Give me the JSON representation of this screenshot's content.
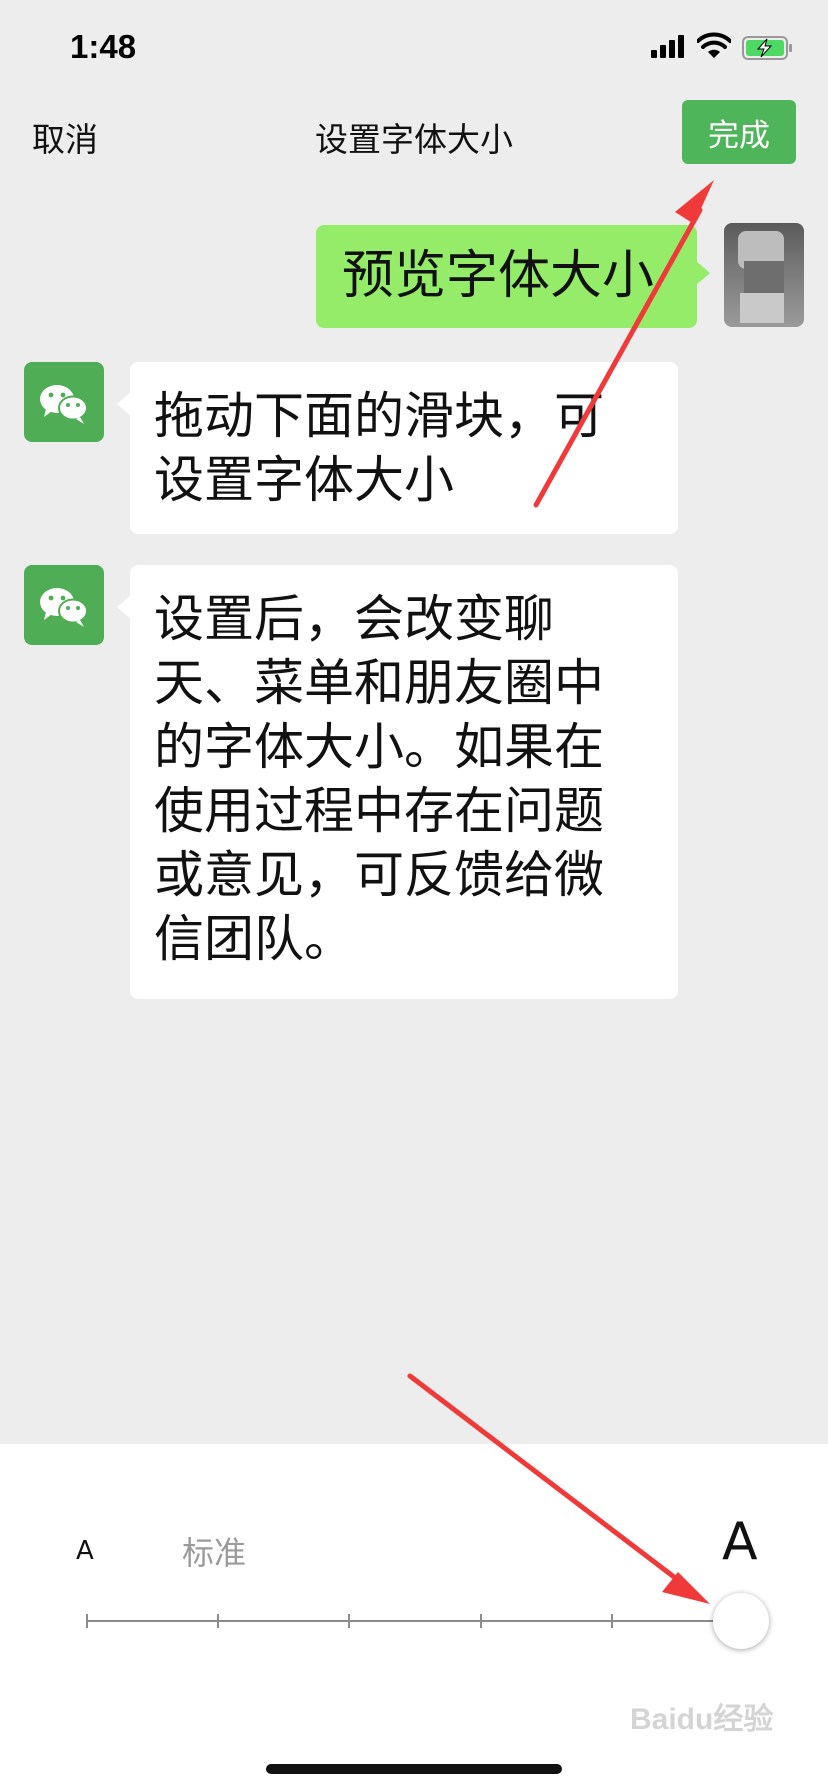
{
  "status_bar": {
    "time": "1:48"
  },
  "nav": {
    "cancel_label": "取消",
    "title": "设置字体大小",
    "done_label": "完成"
  },
  "messages": [
    {
      "from": "me",
      "text": "预览字体大小"
    },
    {
      "from": "wechat",
      "text": "拖动下面的滑块，可\n设置字体大小"
    },
    {
      "from": "wechat",
      "text": "设置后，会改变聊\n天、菜单和朋友圈中\n的字体大小。如果在\n使用过程中存在问题\n或意见，可反馈给微\n信团队。"
    }
  ],
  "font_slider": {
    "small_label": "A",
    "standard_label": "标准",
    "large_label": "A",
    "steps": 6,
    "selected_step": 6
  },
  "watermark": "Baidu经验",
  "colors": {
    "accent": "#4fb55a",
    "my_bubble": "#95ec69",
    "background": "#ededed",
    "annotation_arrow": "#f03a3a"
  }
}
